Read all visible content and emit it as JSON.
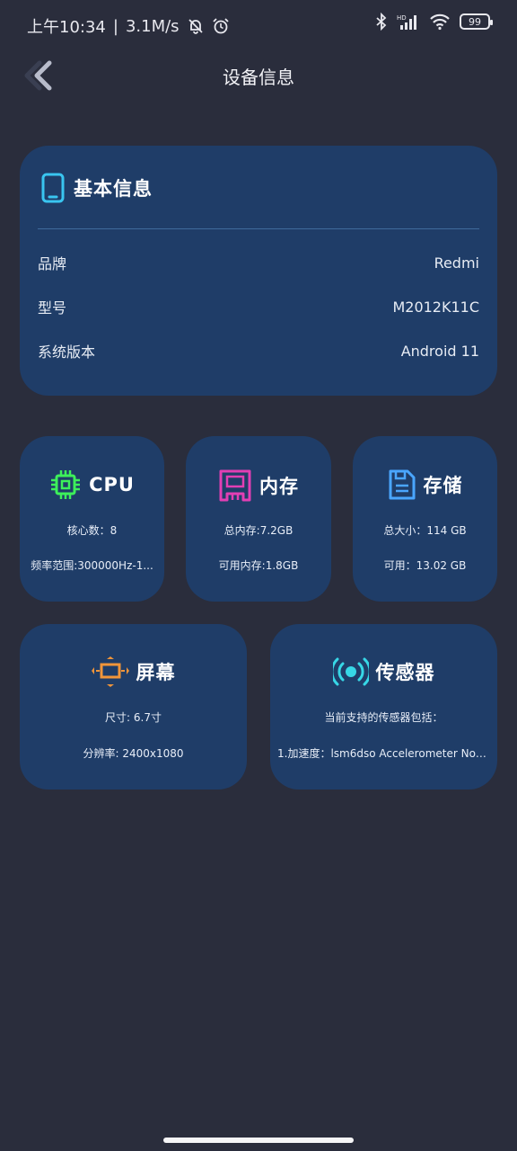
{
  "status_bar": {
    "time": "上午10:34",
    "speed": "3.1M/s",
    "battery": "99"
  },
  "header": {
    "title": "设备信息"
  },
  "basic_info": {
    "title": "基本信息",
    "rows": [
      {
        "label": "品牌",
        "value": "Redmi"
      },
      {
        "label": "型号",
        "value": "M2012K11C"
      },
      {
        "label": "系统版本",
        "value": "Android 11"
      }
    ]
  },
  "cpu": {
    "title": "CPU",
    "cores": "核心数：8",
    "freq": "频率范围:300000Hz-1..."
  },
  "memory": {
    "title": "内存",
    "total": "总内存:7.2GB",
    "available": "可用内存:1.8GB"
  },
  "storage": {
    "title": "存储",
    "total": "总大小：114 GB",
    "available": "可用：13.02 GB"
  },
  "screen": {
    "title": "屏幕",
    "size": "尺寸: 6.7寸",
    "resolution": "分辨率: 2400x1080"
  },
  "sensor": {
    "title": "传感器",
    "intro": "当前支持的传感器包括：",
    "first": "1.加速度：lsm6dso Accelerometer Non..."
  },
  "icons": {
    "back": "chevron-left-icon",
    "phone": "phone-icon",
    "cpu": "cpu-chip-icon",
    "memory": "ram-icon",
    "storage": "floppy-disk-icon",
    "screen": "screen-resize-icon",
    "sensor": "broadcast-icon"
  },
  "colors": {
    "background": "#2a2d3c",
    "card": "#1f3d68",
    "phone_icon": "#39c5f0",
    "cpu_icon": "#3df05a",
    "memory_icon": "#e23fb4",
    "storage_icon": "#4aa6ff",
    "screen_icon": "#f0953a",
    "sensor_icon": "#37d7e6"
  }
}
